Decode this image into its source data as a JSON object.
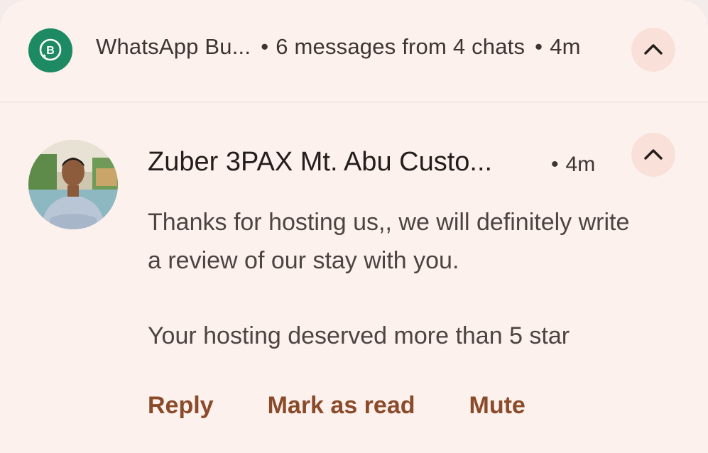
{
  "header": {
    "app_name": "WhatsApp Bu...",
    "separator": "•",
    "summary": "6 messages from 4 chats",
    "time": "4m",
    "app_icon_letter": "B",
    "collapse_icon": "chevron-up-icon"
  },
  "message": {
    "sender": "Zuber 3PAX Mt. Abu Custo...",
    "separator": "•",
    "time": "4m",
    "line1": "Thanks for hosting us,, we will definitely write a review of our stay with you.",
    "line2": "Your hosting deserved more than 5 star",
    "collapse_icon": "chevron-up-icon"
  },
  "actions": {
    "reply": "Reply",
    "mark_read": "Mark as read",
    "mute": "Mute"
  },
  "colors": {
    "background": "#fdf1ee",
    "app_icon": "#1e8a64",
    "action_text": "#8a4b2a",
    "button_bg": "#f9e1da"
  }
}
